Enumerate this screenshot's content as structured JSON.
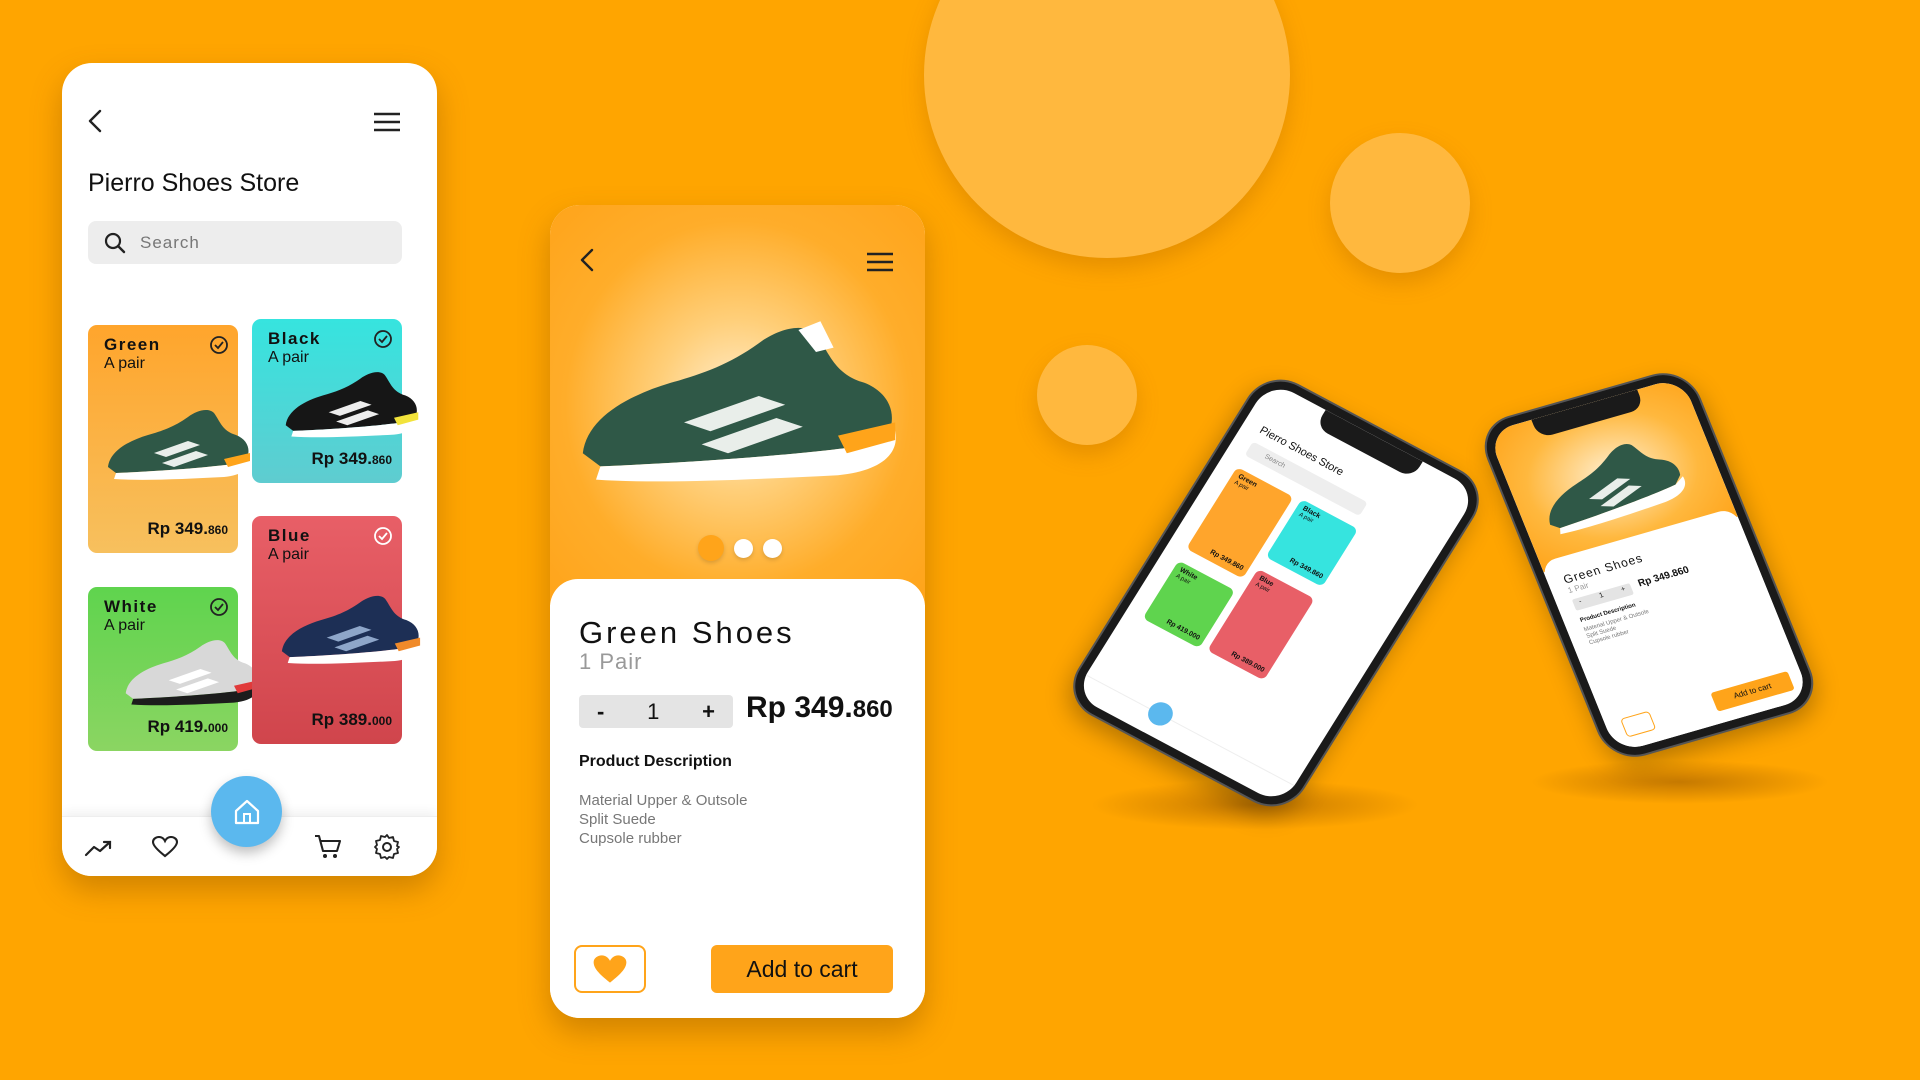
{
  "colors": {
    "background": "#FFA500",
    "accent": "#FFA41A",
    "fab": "#5BB8EE",
    "card_green": "#FFA52C",
    "card_black": "#36E4DF",
    "card_white": "#5FD44E",
    "card_blue": "#E85F67"
  },
  "store": {
    "title": "Pierro Shoes Store",
    "search_placeholder": "Search",
    "products": [
      {
        "name": "Green",
        "sub": "A pair",
        "price_main": "Rp 349.",
        "price_small": "860",
        "icon": "check-circle-icon"
      },
      {
        "name": "Black",
        "sub": "A pair",
        "price_main": "Rp 349.",
        "price_small": "860",
        "icon": "check-circle-icon"
      },
      {
        "name": "White",
        "sub": "A pair",
        "price_main": "Rp 419.",
        "price_small": "000",
        "icon": "check-circle-icon"
      },
      {
        "name": "Blue",
        "sub": "A pair",
        "price_main": "Rp 389.",
        "price_small": "000",
        "icon": "check-circle-icon"
      }
    ],
    "nav": [
      "trending-icon",
      "heart-icon",
      "home-icon",
      "cart-icon",
      "gear-icon"
    ]
  },
  "detail": {
    "name": "Green Shoes",
    "qty_label": "1 Pair",
    "stepper": {
      "minus": "-",
      "value": "1",
      "plus": "+"
    },
    "price_main": "Rp 349.",
    "price_small": "860",
    "carousel": {
      "count": 3,
      "active": 0
    },
    "description_title": "Product Description",
    "description_lines": [
      "Material Upper & Outsole",
      "Split Suede",
      "Cupsole rubber"
    ],
    "cart_button": "Add to cart",
    "fav_icon": "heart-icon"
  },
  "mock_small": {
    "store_title": "Pierro Shoes Store",
    "search": "Search",
    "cards": [
      {
        "name": "Green",
        "sub": "A pair",
        "price": "Rp 349.860"
      },
      {
        "name": "Black",
        "sub": "A pair",
        "price": "Rp 349.860"
      },
      {
        "name": "White",
        "sub": "A pair",
        "price": "Rp 419.000"
      },
      {
        "name": "Blue",
        "sub": "A pair",
        "price": "Rp 389.000"
      }
    ],
    "detail_name": "Green Shoes",
    "detail_qty": "1 Pair",
    "detail_price": "Rp 349.860",
    "detail_minus": "-",
    "detail_value": "1",
    "detail_plus": "+",
    "detail_desc_title": "Product Description",
    "detail_desc_lines": [
      "Material Upper & Outsole",
      "Split Suede",
      "Cupsole rubber"
    ],
    "detail_cart": "Add to cart"
  }
}
